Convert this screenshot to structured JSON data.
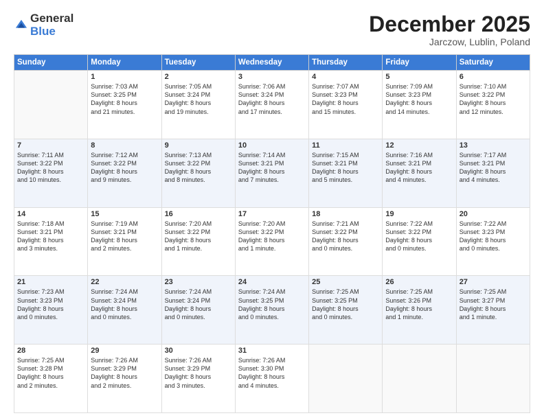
{
  "logo": {
    "general": "General",
    "blue": "Blue"
  },
  "header": {
    "month": "December 2025",
    "location": "Jarczow, Lublin, Poland"
  },
  "weekdays": [
    "Sunday",
    "Monday",
    "Tuesday",
    "Wednesday",
    "Thursday",
    "Friday",
    "Saturday"
  ],
  "rows": [
    [
      {
        "day": "",
        "lines": []
      },
      {
        "day": "1",
        "lines": [
          "Sunrise: 7:03 AM",
          "Sunset: 3:25 PM",
          "Daylight: 8 hours",
          "and 21 minutes."
        ]
      },
      {
        "day": "2",
        "lines": [
          "Sunrise: 7:05 AM",
          "Sunset: 3:24 PM",
          "Daylight: 8 hours",
          "and 19 minutes."
        ]
      },
      {
        "day": "3",
        "lines": [
          "Sunrise: 7:06 AM",
          "Sunset: 3:24 PM",
          "Daylight: 8 hours",
          "and 17 minutes."
        ]
      },
      {
        "day": "4",
        "lines": [
          "Sunrise: 7:07 AM",
          "Sunset: 3:23 PM",
          "Daylight: 8 hours",
          "and 15 minutes."
        ]
      },
      {
        "day": "5",
        "lines": [
          "Sunrise: 7:09 AM",
          "Sunset: 3:23 PM",
          "Daylight: 8 hours",
          "and 14 minutes."
        ]
      },
      {
        "day": "6",
        "lines": [
          "Sunrise: 7:10 AM",
          "Sunset: 3:22 PM",
          "Daylight: 8 hours",
          "and 12 minutes."
        ]
      }
    ],
    [
      {
        "day": "7",
        "lines": [
          "Sunrise: 7:11 AM",
          "Sunset: 3:22 PM",
          "Daylight: 8 hours",
          "and 10 minutes."
        ]
      },
      {
        "day": "8",
        "lines": [
          "Sunrise: 7:12 AM",
          "Sunset: 3:22 PM",
          "Daylight: 8 hours",
          "and 9 minutes."
        ]
      },
      {
        "day": "9",
        "lines": [
          "Sunrise: 7:13 AM",
          "Sunset: 3:22 PM",
          "Daylight: 8 hours",
          "and 8 minutes."
        ]
      },
      {
        "day": "10",
        "lines": [
          "Sunrise: 7:14 AM",
          "Sunset: 3:21 PM",
          "Daylight: 8 hours",
          "and 7 minutes."
        ]
      },
      {
        "day": "11",
        "lines": [
          "Sunrise: 7:15 AM",
          "Sunset: 3:21 PM",
          "Daylight: 8 hours",
          "and 5 minutes."
        ]
      },
      {
        "day": "12",
        "lines": [
          "Sunrise: 7:16 AM",
          "Sunset: 3:21 PM",
          "Daylight: 8 hours",
          "and 4 minutes."
        ]
      },
      {
        "day": "13",
        "lines": [
          "Sunrise: 7:17 AM",
          "Sunset: 3:21 PM",
          "Daylight: 8 hours",
          "and 4 minutes."
        ]
      }
    ],
    [
      {
        "day": "14",
        "lines": [
          "Sunrise: 7:18 AM",
          "Sunset: 3:21 PM",
          "Daylight: 8 hours",
          "and 3 minutes."
        ]
      },
      {
        "day": "15",
        "lines": [
          "Sunrise: 7:19 AM",
          "Sunset: 3:21 PM",
          "Daylight: 8 hours",
          "and 2 minutes."
        ]
      },
      {
        "day": "16",
        "lines": [
          "Sunrise: 7:20 AM",
          "Sunset: 3:22 PM",
          "Daylight: 8 hours",
          "and 1 minute."
        ]
      },
      {
        "day": "17",
        "lines": [
          "Sunrise: 7:20 AM",
          "Sunset: 3:22 PM",
          "Daylight: 8 hours",
          "and 1 minute."
        ]
      },
      {
        "day": "18",
        "lines": [
          "Sunrise: 7:21 AM",
          "Sunset: 3:22 PM",
          "Daylight: 8 hours",
          "and 0 minutes."
        ]
      },
      {
        "day": "19",
        "lines": [
          "Sunrise: 7:22 AM",
          "Sunset: 3:22 PM",
          "Daylight: 8 hours",
          "and 0 minutes."
        ]
      },
      {
        "day": "20",
        "lines": [
          "Sunrise: 7:22 AM",
          "Sunset: 3:23 PM",
          "Daylight: 8 hours",
          "and 0 minutes."
        ]
      }
    ],
    [
      {
        "day": "21",
        "lines": [
          "Sunrise: 7:23 AM",
          "Sunset: 3:23 PM",
          "Daylight: 8 hours",
          "and 0 minutes."
        ]
      },
      {
        "day": "22",
        "lines": [
          "Sunrise: 7:24 AM",
          "Sunset: 3:24 PM",
          "Daylight: 8 hours",
          "and 0 minutes."
        ]
      },
      {
        "day": "23",
        "lines": [
          "Sunrise: 7:24 AM",
          "Sunset: 3:24 PM",
          "Daylight: 8 hours",
          "and 0 minutes."
        ]
      },
      {
        "day": "24",
        "lines": [
          "Sunrise: 7:24 AM",
          "Sunset: 3:25 PM",
          "Daylight: 8 hours",
          "and 0 minutes."
        ]
      },
      {
        "day": "25",
        "lines": [
          "Sunrise: 7:25 AM",
          "Sunset: 3:25 PM",
          "Daylight: 8 hours",
          "and 0 minutes."
        ]
      },
      {
        "day": "26",
        "lines": [
          "Sunrise: 7:25 AM",
          "Sunset: 3:26 PM",
          "Daylight: 8 hours",
          "and 1 minute."
        ]
      },
      {
        "day": "27",
        "lines": [
          "Sunrise: 7:25 AM",
          "Sunset: 3:27 PM",
          "Daylight: 8 hours",
          "and 1 minute."
        ]
      }
    ],
    [
      {
        "day": "28",
        "lines": [
          "Sunrise: 7:25 AM",
          "Sunset: 3:28 PM",
          "Daylight: 8 hours",
          "and 2 minutes."
        ]
      },
      {
        "day": "29",
        "lines": [
          "Sunrise: 7:26 AM",
          "Sunset: 3:29 PM",
          "Daylight: 8 hours",
          "and 2 minutes."
        ]
      },
      {
        "day": "30",
        "lines": [
          "Sunrise: 7:26 AM",
          "Sunset: 3:29 PM",
          "Daylight: 8 hours",
          "and 3 minutes."
        ]
      },
      {
        "day": "31",
        "lines": [
          "Sunrise: 7:26 AM",
          "Sunset: 3:30 PM",
          "Daylight: 8 hours",
          "and 4 minutes."
        ]
      },
      {
        "day": "",
        "lines": []
      },
      {
        "day": "",
        "lines": []
      },
      {
        "day": "",
        "lines": []
      }
    ]
  ]
}
